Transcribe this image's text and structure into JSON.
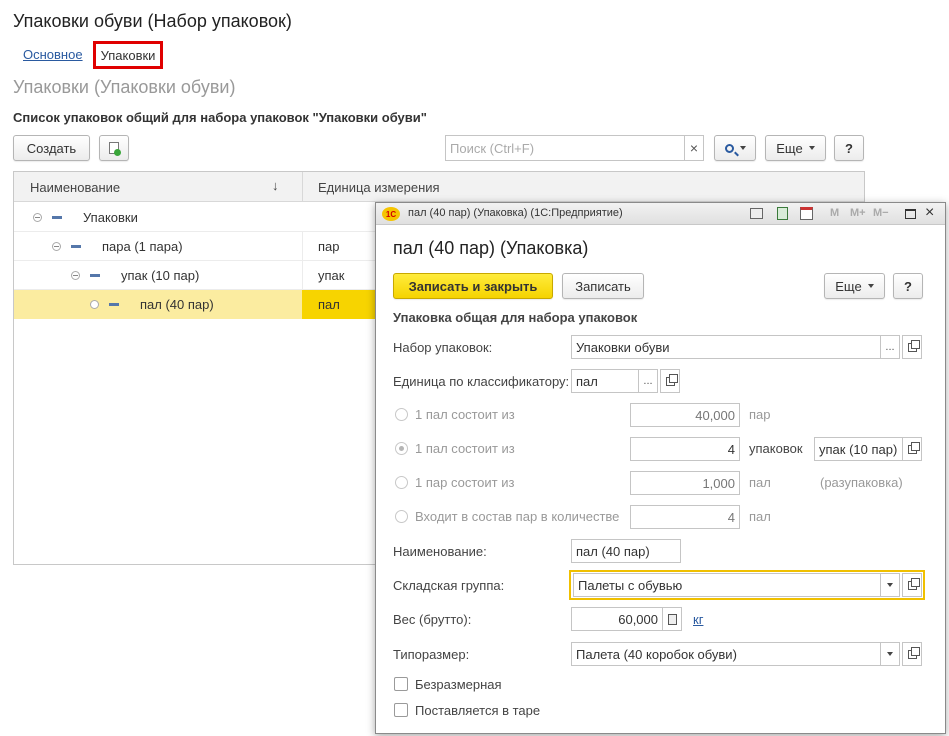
{
  "main": {
    "title": "Упаковки обуви (Набор упаковок)",
    "tabs": [
      {
        "label": "Основное"
      },
      {
        "label": "Упаковки"
      }
    ],
    "subtitle": "Упаковки (Упаковки обуви)",
    "list_heading": "Список упаковок общий для набора упаковок \"Упаковки обуви\"",
    "create_label": "Создать",
    "search_placeholder": "Поиск (Ctrl+F)",
    "search_clear": "×",
    "more_label": "Еще",
    "help_label": "?",
    "columns": [
      "Наименование",
      "Единица измерения"
    ],
    "sort_arrow": "↓",
    "rows": [
      {
        "name": "Упаковки",
        "unit": ""
      },
      {
        "name": "пара (1 пара)",
        "unit": "пар"
      },
      {
        "name": "упак (10 пар)",
        "unit": "упак"
      },
      {
        "name": "пал (40 пар)",
        "unit": "пал"
      }
    ]
  },
  "dialog": {
    "window_title": "пал (40 пар) (Упаковка)  (1С:Предприятие)",
    "logo": "1С",
    "title_icons": [
      "M",
      "M+",
      "M−"
    ],
    "title": "пал (40 пар) (Упаковка)",
    "save_close_label": "Записать и закрыть",
    "save_label": "Записать",
    "more_label": "Еще",
    "help_label": "?",
    "section_heading": "Упаковка общая для набора упаковок",
    "set_label": "Набор упаковок:",
    "set_value": "Упаковки обуви",
    "unit_label": "Единица по классификатору:",
    "unit_value": "пал",
    "dots": "...",
    "options": [
      {
        "label": "1 пал состоит из",
        "value": "40,000",
        "unit": "пар",
        "extra": ""
      },
      {
        "label": "1 пал состоит из",
        "value": "4",
        "unit": "упаковок",
        "extra": "упак (10 пар)"
      },
      {
        "label": "1 пар состоит из",
        "value": "1,000",
        "unit": "пал",
        "extra": "(разупаковка)"
      },
      {
        "label": "Входит в состав пар в количестве",
        "value": "4",
        "unit": "пал",
        "extra": ""
      }
    ],
    "name_label": "Наименование:",
    "name_value": "пал (40 пар)",
    "group_label": "Складская группа:",
    "group_value": "Палеты с обувью",
    "weight_label": "Вес (брутто):",
    "weight_value": "60,000",
    "weight_unit": "кг",
    "size_label": "Типоразмер:",
    "size_value": "Палета (40 коробок обуви)",
    "checkbox1": "Безразмерная",
    "checkbox2": "Поставляется в таре",
    "accent_yellow": "#f5d300",
    "highlight_row": "#fbeca0"
  }
}
